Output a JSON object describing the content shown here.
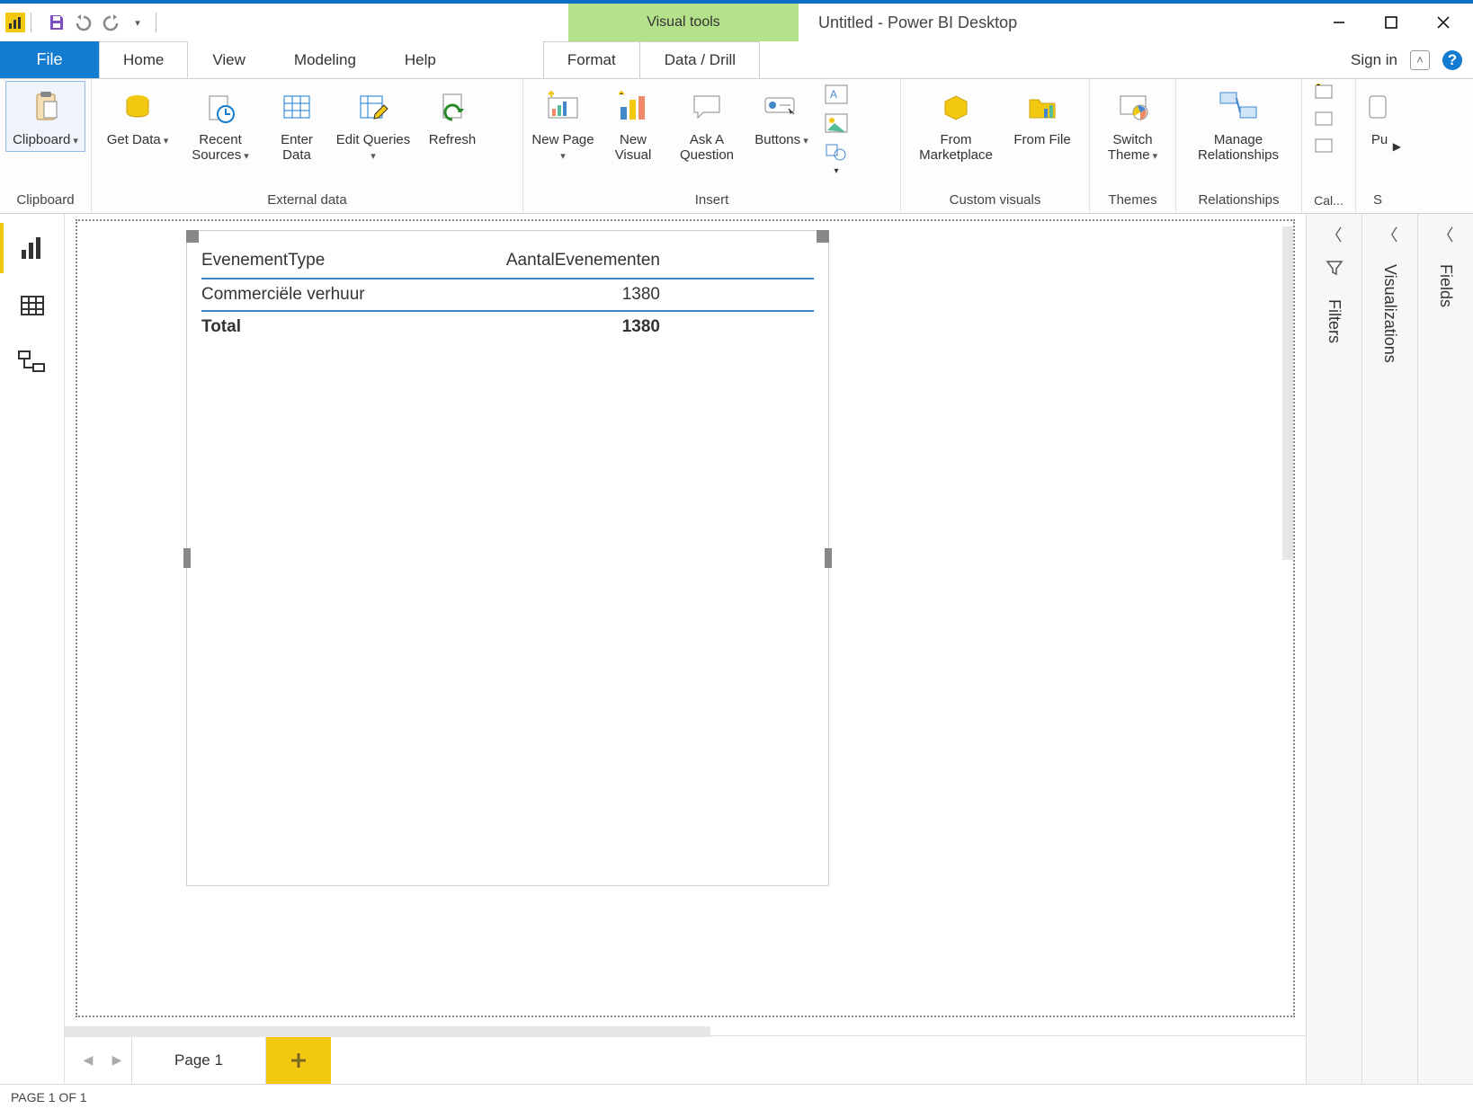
{
  "title": "Untitled - Power BI Desktop",
  "visual_tools_label": "Visual tools",
  "tabs": {
    "file": "File",
    "home": "Home",
    "view": "View",
    "modeling": "Modeling",
    "help": "Help",
    "format": "Format",
    "data_drill": "Data / Drill"
  },
  "sign_in": "Sign in",
  "ribbon": {
    "clipboard": {
      "label": "Clipboard"
    },
    "external_data": {
      "label": "External data",
      "get_data": "Get Data",
      "recent_sources": "Recent Sources",
      "enter_data": "Enter Data",
      "edit_queries": "Edit Queries",
      "refresh": "Refresh"
    },
    "insert": {
      "label": "Insert",
      "new_page": "New Page",
      "new_visual": "New Visual",
      "ask_question": "Ask A Question",
      "buttons": "Buttons"
    },
    "custom_visuals": {
      "label": "Custom visuals",
      "from_marketplace": "From Marketplace",
      "from_file": "From File"
    },
    "themes": {
      "label": "Themes",
      "switch_theme": "Switch Theme"
    },
    "relationships": {
      "label": "Relationships",
      "manage": "Manage Relationships"
    },
    "calculations": {
      "label": "Cal...",
      "pu": "Pu"
    },
    "share": {
      "label": "S"
    }
  },
  "table": {
    "columns": [
      "EvenementType",
      "AantalEvenementen"
    ],
    "rows": [
      {
        "c0": "Commerciële verhuur",
        "c1": "1380"
      }
    ],
    "total_label": "Total",
    "total_value": "1380"
  },
  "panes": {
    "filters": "Filters",
    "visualizations": "Visualizations",
    "fields": "Fields"
  },
  "page_tab": "Page 1",
  "status": "PAGE 1 OF 1"
}
